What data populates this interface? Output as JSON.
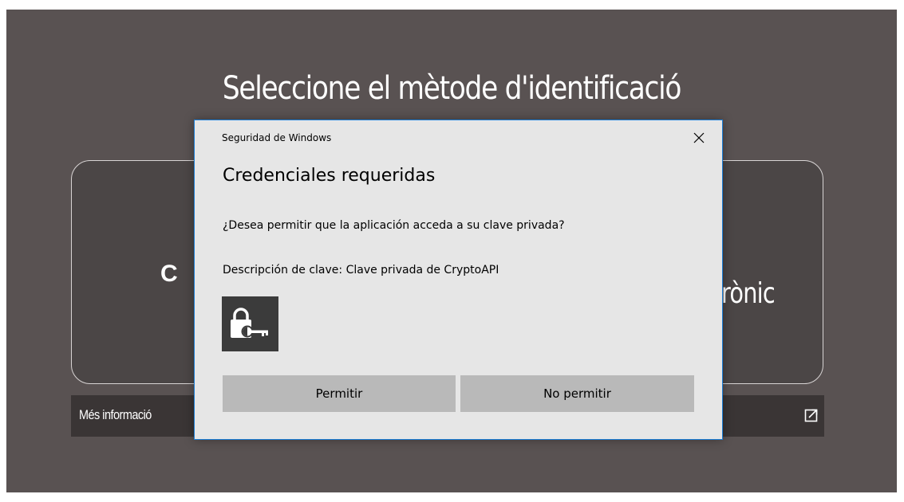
{
  "background": {
    "title": "Seleccione el mètode d'identificació",
    "card_left_text": "C",
    "card_right_text": "rònic",
    "info_label": "Més informació",
    "external_link_icon": "external-link-icon"
  },
  "dialog": {
    "app_name": "Seguridad de Windows",
    "close_icon": "close-icon",
    "title": "Credenciales requeridas",
    "question": "¿Desea permitir que la aplicación acceda a su clave privada?",
    "key_description": "Descripción de clave: Clave privada de CryptoAPI",
    "key_icon": "lock-key-icon",
    "allow_label": "Permitir",
    "deny_label": "No permitir"
  },
  "colors": {
    "backdrop": "#595252",
    "dialog_bg": "#e6e6e6",
    "dialog_border": "#1a7dd6",
    "button_bg": "#b9b9b9"
  }
}
